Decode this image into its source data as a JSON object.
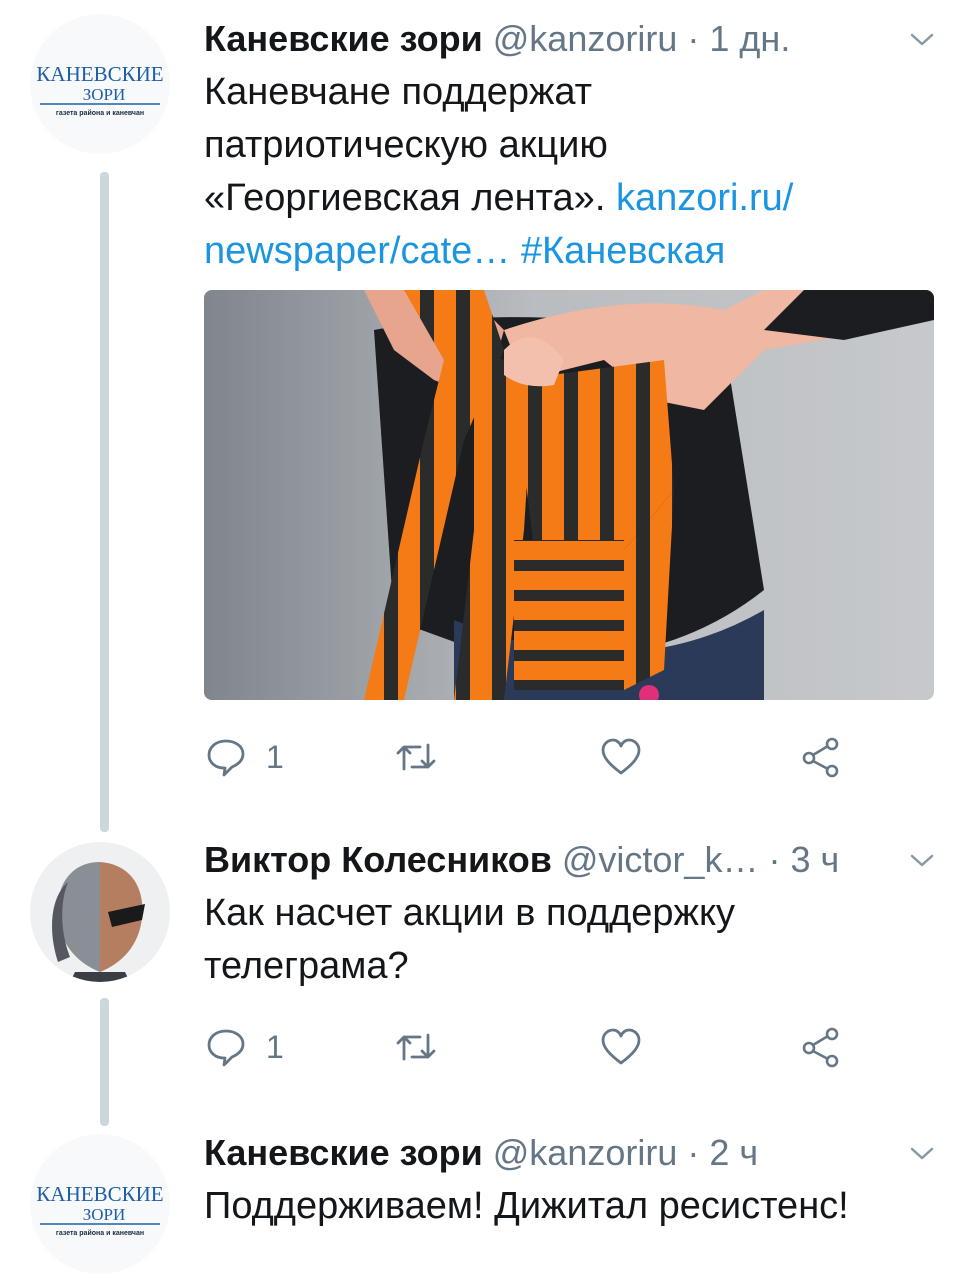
{
  "tweets": [
    {
      "name": "Каневские зори",
      "handle": "@kanzoriru",
      "separator": "·",
      "time": "1 дн.",
      "text": "Каневчане поддержат\nпатриотическую акцию\n«Георгиевская лента». ",
      "link1": "kanzori.ru/\nnewspaper/cate…",
      "hashtag": "#Каневская",
      "reply_count": "1"
    },
    {
      "name": "Виктор Колесников",
      "handle": "@victor_k…",
      "separator": "·",
      "time": "3 ч",
      "text": "Как насчет акции в поддержку\nтелеграма?",
      "reply_count": "1"
    },
    {
      "name": "Каневские зори",
      "handle": "@kanzoriru",
      "separator": "·",
      "time": "2 ч",
      "text": "Поддерживаем! Дижитал ресистенс!"
    }
  ],
  "logo": {
    "line1": "КАНЕВСКИЕ",
    "line2": "ЗОРИ",
    "tagline": "газета района и каневчан"
  },
  "colors": {
    "link": "#1b95e0",
    "muted": "#657786",
    "thread": "#ccd6dd",
    "logo_blue": "#1f5fa8",
    "ribbon_orange": "#f47b16"
  }
}
